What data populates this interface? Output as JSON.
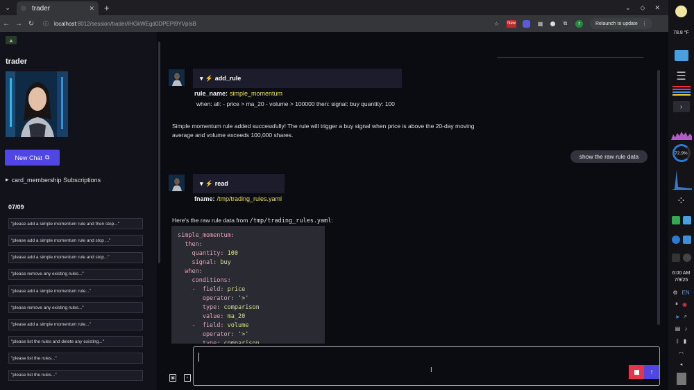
{
  "browser": {
    "tab_title": "trader",
    "tab_close": "✕",
    "new_tab": "+",
    "url_host": "localhost",
    "url_path": ":8012/session/trader/lHGkWEgd0DPEPl9YVpIsB",
    "ext_new_label": "New",
    "profile_initial": "r",
    "relaunch_label": "Relaunch to update"
  },
  "sidebar": {
    "title": "trader",
    "new_chat_label": "New Chat",
    "subscriptions_label": "card_membership  Subscriptions",
    "date_header": "07/09",
    "history": [
      "\"please add a simple momentum rule and then stop...\"",
      "\"please add a simple momentum rule and stop ...\"",
      "\"please add a simple momentum rule and stop...\"",
      "\"please remove any existing rules...\"",
      "\"please add a simple momentum rule...\"",
      "\"please remove any existing rules...\"",
      "\"please add a simple momentum rule...\"",
      "\"please list the rules and delete any existing...\"",
      "\"please list the rules...\"",
      "\"please list the rules...\""
    ]
  },
  "chat": {
    "tool1": {
      "name": "add_rule",
      "param_key": "rule_name:",
      "param_val": "simple_momentum",
      "body": "when: all: - price > ma_20 - volume > 100000 then: signal: buy quantity: 100"
    },
    "assistant1_line1": "Simple momentum rule added successfully! The rule will trigger a buy signal when price is above the 20-day moving",
    "assistant1_line2": "average and volume exceeds 100,000 shares.",
    "user_msg": "show the raw rule data",
    "tool2": {
      "name": "read",
      "param_key": "fname:",
      "param_val": "/tmp/trading_rules.yaml"
    },
    "assistant2_prefix": "Here's the raw rule data from ",
    "assistant2_code": "/tmp/trading_rules.yaml",
    "assistant2_suffix": ":",
    "yaml": [
      {
        "k": "simple_momentum:",
        "v": ""
      },
      {
        "k": "  then:",
        "v": ""
      },
      {
        "k": "    quantity:",
        "v": " 100"
      },
      {
        "k": "    signal:",
        "v": " buy"
      },
      {
        "k": "  when:",
        "v": ""
      },
      {
        "k": "    conditions:",
        "v": ""
      },
      {
        "k": "    -  field:",
        "v": " price"
      },
      {
        "k": "       operator:",
        "v": " '>'"
      },
      {
        "k": "       type:",
        "v": " comparison"
      },
      {
        "k": "       value:",
        "v": " ma_20"
      },
      {
        "k": "    -  field:",
        "v": " volume"
      },
      {
        "k": "       operator:",
        "v": " '>'"
      },
      {
        "k": "       type:",
        "v": " comparison"
      }
    ]
  },
  "os": {
    "temperature": "78.8 °F",
    "cpu": "72.9%",
    "time": "6:00 AM",
    "date": "7/9/25",
    "lang": "EN"
  }
}
